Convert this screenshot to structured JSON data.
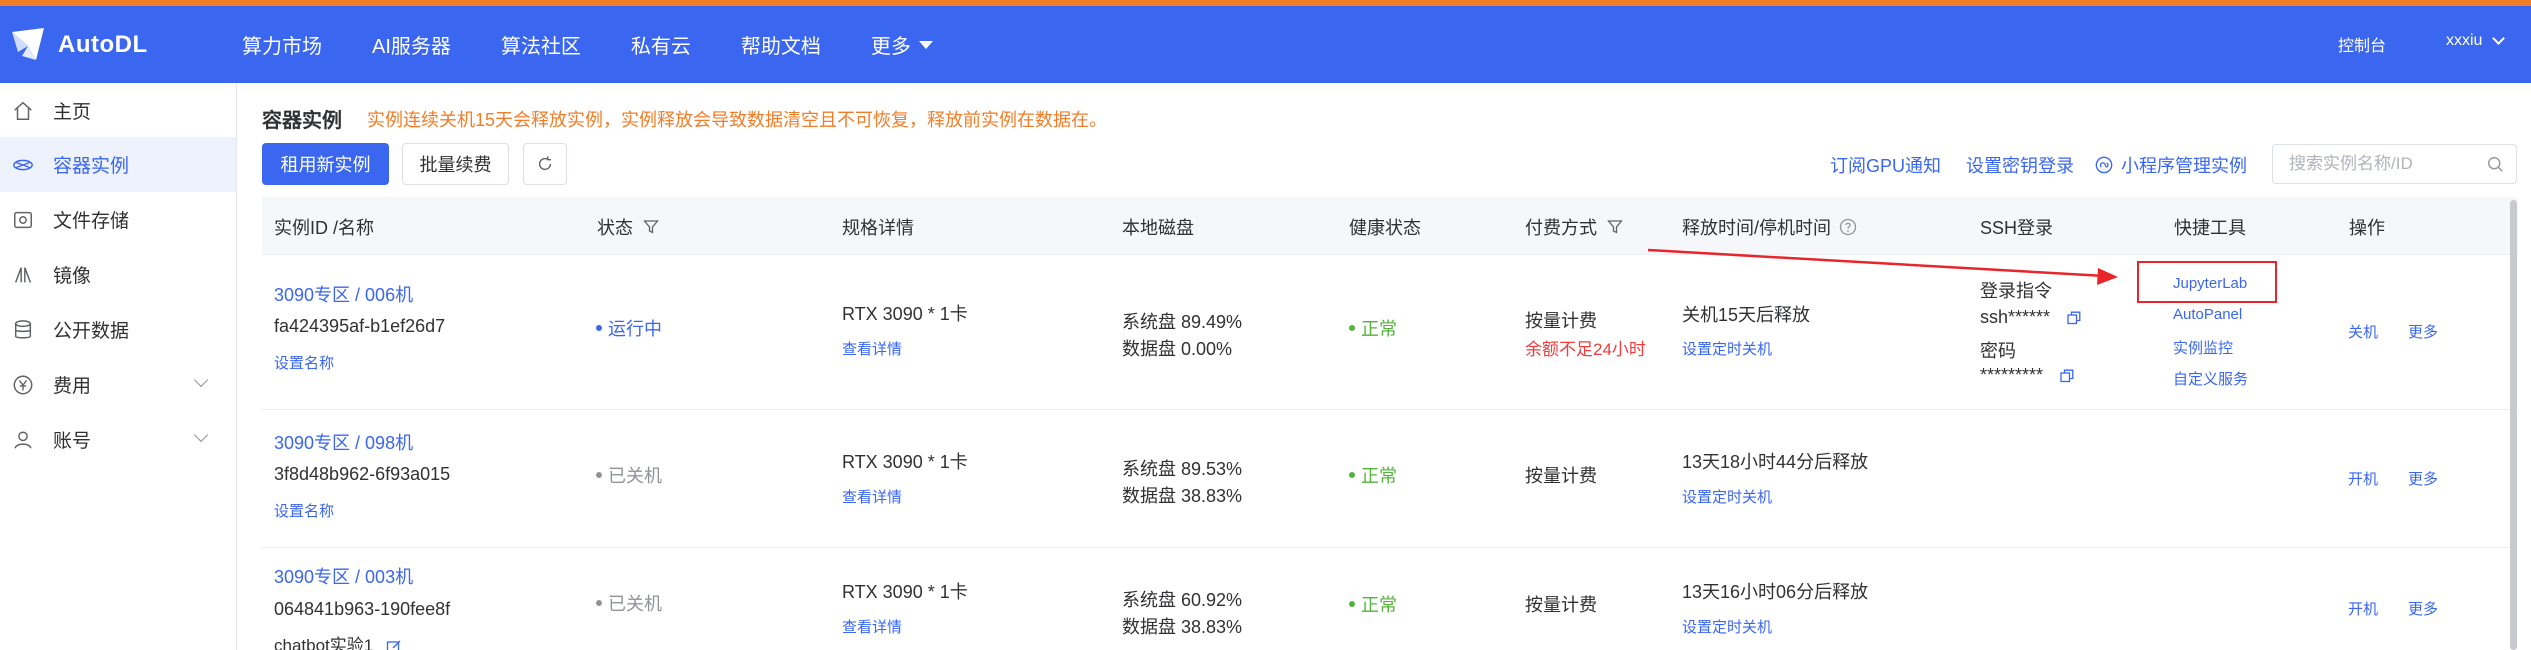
{
  "header": {
    "logo_text": "AutoDL",
    "nav": [
      "算力市场",
      "AI服务器",
      "算法社区",
      "私有云",
      "帮助文档",
      "更多"
    ],
    "console_label": "控制台",
    "username": "xxxiu",
    "colors": {
      "top_stripe": "#f27d28",
      "bar": "#3a66f0"
    }
  },
  "sidebar": {
    "items": [
      {
        "label": "主页",
        "icon": "home-icon",
        "active": false,
        "expandable": false
      },
      {
        "label": "容器实例",
        "icon": "container-icon",
        "active": true,
        "expandable": false
      },
      {
        "label": "文件存储",
        "icon": "file-storage-icon",
        "active": false,
        "expandable": false
      },
      {
        "label": "镜像",
        "icon": "image-icon",
        "active": false,
        "expandable": false
      },
      {
        "label": "公开数据",
        "icon": "database-icon",
        "active": false,
        "expandable": false
      },
      {
        "label": "费用",
        "icon": "yen-icon",
        "active": false,
        "expandable": true
      },
      {
        "label": "账号",
        "icon": "user-icon",
        "active": false,
        "expandable": true
      }
    ]
  },
  "main": {
    "title": "容器实例",
    "warning": "实例连续关机15天会释放实例，实例释放会导致数据清空且不可恢复，释放前实例在数据在。",
    "buttons": {
      "rent": "租用新实例",
      "renew": "批量续费"
    },
    "links": {
      "subscribe": "订阅GPU通知",
      "ssh_key": "设置密钥登录",
      "miniapp": "小程序管理实例"
    },
    "search_placeholder": "搜索实例名称/ID"
  },
  "table": {
    "headers": [
      "实例ID /名称",
      "状态",
      "规格详情",
      "本地磁盘",
      "健康状态",
      "付费方式",
      "释放时间/停机时间",
      "SSH登录",
      "快捷工具",
      "操作"
    ],
    "rows": [
      {
        "name": "3090专区 / 006机",
        "id": "fa424395af-b1ef26d7",
        "set_name": "设置名称",
        "status": "运行中",
        "status_type": "running",
        "spec": "RTX 3090 * 1卡",
        "spec_link": "查看详情",
        "disk_sys": "系统盘 89.49%",
        "disk_data": "数据盘 0.00%",
        "health": "正常",
        "billing": "按量计费",
        "billing_warn": "余额不足24小时",
        "release": "关机15天后释放",
        "release_link": "设置定时关机",
        "ssh": {
          "cmd_label": "登录指令",
          "cmd_value": "ssh******",
          "pwd_label": "密码",
          "pwd_value": "*********"
        },
        "tools": [
          "JupyterLab",
          "AutoPanel",
          "实例监控",
          "自定义服务"
        ],
        "actions": [
          "关机",
          "更多"
        ]
      },
      {
        "name": "3090专区 / 098机",
        "id": "3f8d48b962-6f93a015",
        "set_name": "设置名称",
        "status": "已关机",
        "status_type": "stopped",
        "spec": "RTX 3090 * 1卡",
        "spec_link": "查看详情",
        "disk_sys": "系统盘 89.53%",
        "disk_data": "数据盘 38.83%",
        "health": "正常",
        "billing": "按量计费",
        "release": "13天18小时44分后释放",
        "release_link": "设置定时关机",
        "actions": [
          "开机",
          "更多"
        ]
      },
      {
        "name": "3090专区 / 003机",
        "id": "064841b963-190fee8f",
        "set_name": "chatbot实验1",
        "status": "已关机",
        "status_type": "stopped",
        "spec": "RTX 3090 * 1卡",
        "spec_link": "查看详情",
        "disk_sys": "系统盘 60.92%",
        "disk_data": "数据盘 38.83%",
        "health": "正常",
        "billing": "按量计费",
        "release": "13天16小时06分后释放",
        "release_link": "设置定时关机",
        "actions": [
          "开机",
          "更多"
        ]
      }
    ]
  }
}
